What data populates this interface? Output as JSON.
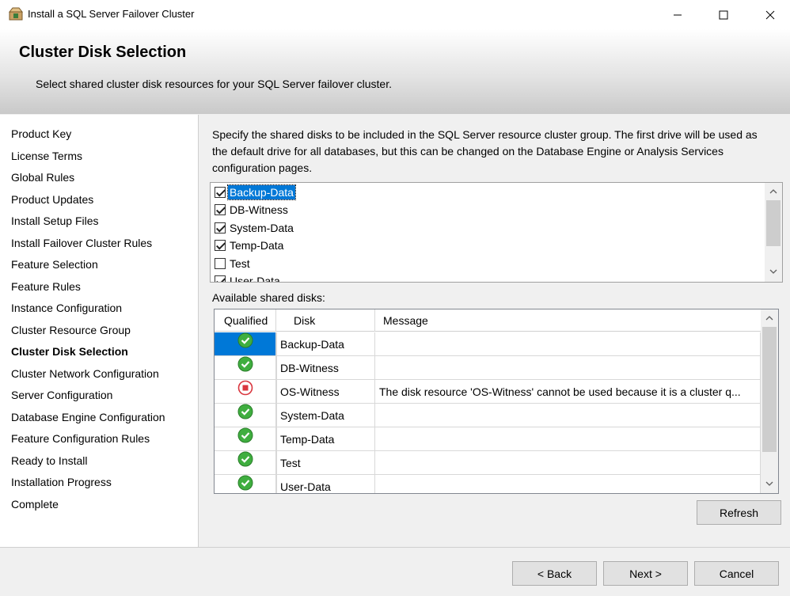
{
  "window": {
    "title": "Install a SQL Server Failover Cluster"
  },
  "header": {
    "title": "Cluster Disk Selection",
    "subtitle": "Select shared cluster disk resources for your SQL Server failover cluster."
  },
  "nav": {
    "items": [
      {
        "label": "Product Key"
      },
      {
        "label": "License Terms"
      },
      {
        "label": "Global Rules"
      },
      {
        "label": "Product Updates"
      },
      {
        "label": "Install Setup Files"
      },
      {
        "label": "Install Failover Cluster Rules"
      },
      {
        "label": "Feature Selection"
      },
      {
        "label": "Feature Rules"
      },
      {
        "label": "Instance Configuration"
      },
      {
        "label": "Cluster Resource Group"
      },
      {
        "label": "Cluster Disk Selection"
      },
      {
        "label": "Cluster Network Configuration"
      },
      {
        "label": "Server Configuration"
      },
      {
        "label": "Database Engine Configuration"
      },
      {
        "label": "Feature Configuration Rules"
      },
      {
        "label": "Ready to Install"
      },
      {
        "label": "Installation Progress"
      },
      {
        "label": "Complete"
      }
    ],
    "active": "Cluster Disk Selection"
  },
  "main": {
    "description": "Specify the shared disks to be included in the SQL Server resource cluster group. The first drive will be used as the default drive for all databases, but this can be changed on the Database Engine or Analysis Services configuration pages.",
    "disk_checklist": [
      {
        "label": "Backup-Data",
        "checked": true
      },
      {
        "label": "DB-Witness",
        "checked": true
      },
      {
        "label": "System-Data",
        "checked": true
      },
      {
        "label": "Temp-Data",
        "checked": true
      },
      {
        "label": "Test",
        "checked": false
      },
      {
        "label": "User-Data",
        "checked": true
      }
    ],
    "available_label": "Available shared disks:",
    "grid": {
      "columns": [
        "Qualified",
        "Disk",
        "Message"
      ],
      "rows": [
        {
          "status": "ok",
          "disk": "Backup-Data",
          "message": ""
        },
        {
          "status": "ok",
          "disk": "DB-Witness",
          "message": ""
        },
        {
          "status": "error",
          "disk": "OS-Witness",
          "message": "The disk resource 'OS-Witness' cannot be used because it is a cluster q..."
        },
        {
          "status": "ok",
          "disk": "System-Data",
          "message": ""
        },
        {
          "status": "ok",
          "disk": "Temp-Data",
          "message": ""
        },
        {
          "status": "ok",
          "disk": "Test",
          "message": ""
        },
        {
          "status": "ok",
          "disk": "User-Data",
          "message": ""
        }
      ]
    },
    "refresh_label": "Refresh"
  },
  "footer": {
    "back_label": "< Back",
    "next_label": "Next >",
    "cancel_label": "Cancel"
  },
  "colors": {
    "selection": "#0078d7",
    "ok_green": "#3fae3f",
    "error_red": "#d9363e"
  },
  "icons": {
    "app": "installer-box-icon",
    "ok": "green-check-circle-icon",
    "error": "red-stop-circle-icon"
  }
}
